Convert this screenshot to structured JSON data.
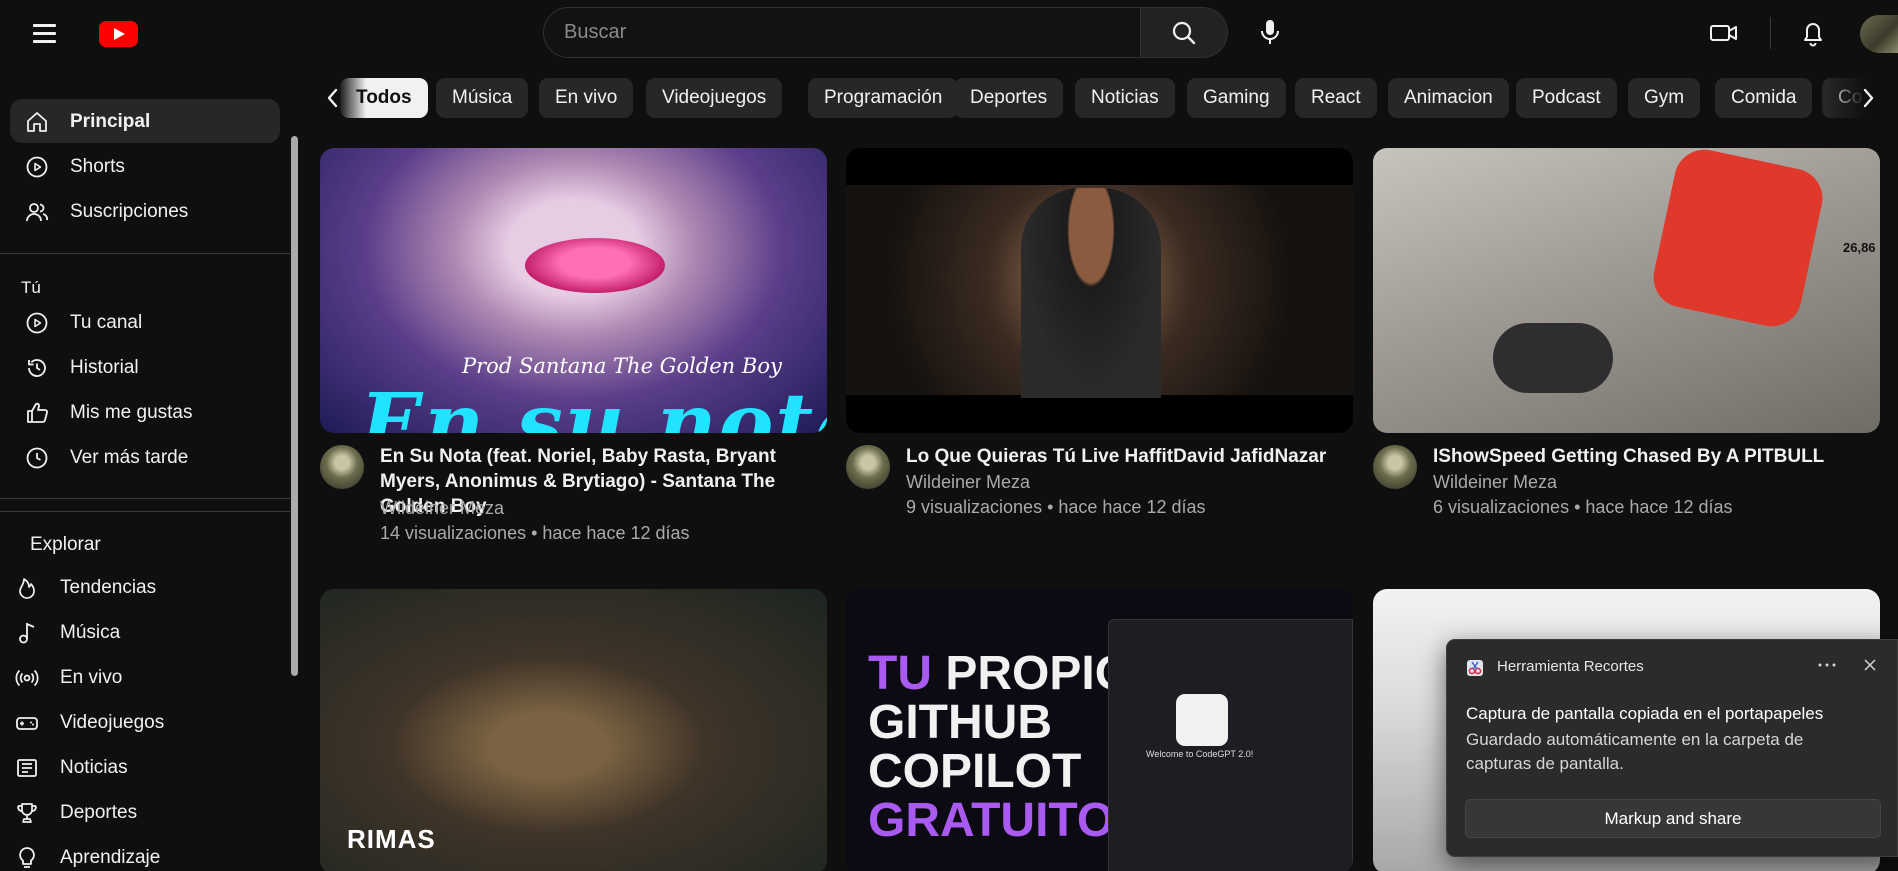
{
  "header": {
    "search": {
      "placeholder": "Buscar",
      "value": ""
    },
    "icons": [
      "menu-icon",
      "youtube-logo",
      "search-icon",
      "mic-icon",
      "create-video-icon",
      "notifications-bell-icon",
      "avatar"
    ]
  },
  "sidebar": {
    "main": [
      {
        "label": "Principal",
        "icon": "home-icon",
        "active": true
      },
      {
        "label": "Shorts",
        "icon": "shorts-icon"
      },
      {
        "label": "Suscripciones",
        "icon": "subscriptions-icon"
      }
    ],
    "you_heading": "Tú",
    "you": [
      {
        "label": "Tu canal",
        "icon": "your-channel-icon"
      },
      {
        "label": "Historial",
        "icon": "history-icon"
      },
      {
        "label": "Mis me gustas",
        "icon": "like-icon"
      },
      {
        "label": "Ver más tarde",
        "icon": "watch-later-icon"
      }
    ],
    "explore_heading": "Explorar",
    "explore": [
      {
        "label": "Tendencias",
        "icon": "trending-icon"
      },
      {
        "label": "Música",
        "icon": "music-icon"
      },
      {
        "label": "En vivo",
        "icon": "live-icon"
      },
      {
        "label": "Videojuegos",
        "icon": "gaming-icon"
      },
      {
        "label": "Noticias",
        "icon": "news-icon"
      },
      {
        "label": "Deportes",
        "icon": "sports-icon"
      },
      {
        "label": "Aprendizaje",
        "icon": "learning-icon"
      }
    ]
  },
  "chips": [
    "Todos",
    "Música",
    "En vivo",
    "Videojuegos",
    "Programación",
    "Deportes",
    "Noticias",
    "Gaming",
    "React",
    "Animacion",
    "Podcast",
    "Gym",
    "Comida",
    "Co"
  ],
  "videos": [
    {
      "title": "En Su Nota (feat. Noriel, Baby Rasta, Bryant Myers, Anonimus & Brytiago) - Santana The Golden Boy",
      "channel": "Wildeiner Meza",
      "views": "14 visualizaciones • hace hace 12 días",
      "thumb_text": [
        "Prod Santana The Golden Boy",
        "En su nota"
      ]
    },
    {
      "title": "Lo Que Quieras Tú Live HaffitDavid JafidNazar",
      "channel": "Wildeiner Meza",
      "views": "9 visualizaciones • hace hace 12 días"
    },
    {
      "title": "IShowSpeed Getting Chased By A PITBULL",
      "channel": "Wildeiner Meza",
      "views": "6 visualizaciones • hace hace 12 días",
      "thumb_text": [
        "26,86"
      ]
    },
    {
      "thumb_text": [
        "RIMAS"
      ]
    },
    {
      "thumb_text": [
        "TU",
        "PROPIO",
        "GITHUB",
        "COPILOT",
        "GRATUITO",
        "Welcome to CodeGPT 2.0!"
      ]
    },
    {
      "thumb_text": []
    }
  ],
  "toast": {
    "app_name": "Herramienta Recortes",
    "title": "Captura de pantalla copiada en el portapapeles",
    "body": "Guardado automáticamente en la carpeta de capturas de pantalla.",
    "button": "Markup and share",
    "more": "⋯",
    "close": "✕"
  },
  "colors": {
    "background": "#0f0f0f",
    "brand_red": "#ff0000",
    "chip_bg": "#272727",
    "chip_active_bg": "#f1f1f1",
    "accent_purple": "#a95af0"
  }
}
